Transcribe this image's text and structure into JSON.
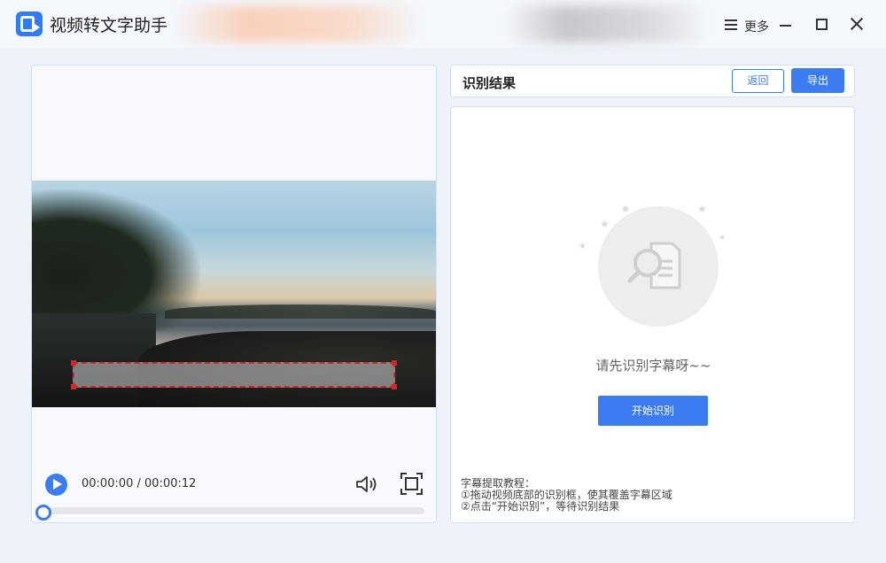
{
  "app": {
    "title": "视频转文字助手",
    "more_label": "更多",
    "logo_icon": "video-text-logo-icon",
    "accent_color": "#3b7cf2"
  },
  "player": {
    "time_display": "00:00:00 / 00:00:12",
    "progress": 0
  },
  "result": {
    "title": "识别结果",
    "back_label": "返回",
    "export_label": "导出",
    "empty_message": "请先识别字幕呀~~",
    "start_label": "开始识别",
    "tutorial": {
      "heading": "字幕提取教程：",
      "steps": [
        "①拖动视频底部的识别框，使其覆盖字幕区域",
        "②点击“开始识别”，等待识别结果"
      ]
    }
  }
}
